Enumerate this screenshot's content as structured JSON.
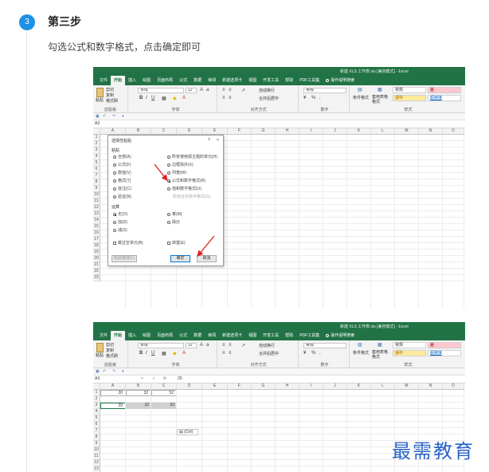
{
  "step": {
    "number": "3",
    "title": "第三步",
    "description": "勾选公式和数字格式，点击确定即可"
  },
  "excel": {
    "title1": "新建 XLS 工作表.xls [兼容模式] - Excel",
    "title2": "新建 XLS 工作表.xls [兼容模式] - Excel",
    "tabs": [
      "文件",
      "开始",
      "插入",
      "绘图",
      "页面布局",
      "公式",
      "数据",
      "审阅",
      "新建选项卡",
      "视图",
      "开发工具",
      "帮助",
      "PDF工具集",
      "操作说明搜索"
    ],
    "ribbon": {
      "paste": "粘贴",
      "cut": "剪切",
      "copy": "复制",
      "format_painter": "格式刷",
      "clipboard_label": "剪贴板",
      "font_name": "宋体",
      "font_size": "12",
      "font_label": "字体",
      "wrap_text": "自动换行",
      "merge_center": "合并后居中",
      "align_label": "对齐方式",
      "number_format": "常规",
      "number_label": "数字",
      "cond_format": "条件格式",
      "table_format": "套用表格格式",
      "style_normal": "常规",
      "style_bad": "差",
      "style_neutral": "适中",
      "style_hyperlink": "超链接",
      "styles_label": "样式"
    },
    "name_box": "A3",
    "formula_value": "20",
    "columns": [
      "A",
      "B",
      "C",
      "D",
      "E",
      "F",
      "G",
      "H",
      "I",
      "J",
      "K",
      "L",
      "M",
      "N",
      "O"
    ],
    "rows1": [
      "1",
      "2",
      "3",
      "4",
      "5",
      "6",
      "7",
      "8",
      "9",
      "10",
      "11",
      "12",
      "13",
      "14",
      "15",
      "16",
      "17",
      "18",
      "19",
      "20",
      "21",
      "22",
      "23"
    ],
    "rows2": [
      "1",
      "2",
      "3",
      "4",
      "5",
      "6",
      "7",
      "8",
      "9",
      "10",
      "11",
      "12",
      "13",
      "14"
    ],
    "cells2": {
      "r1": [
        "20",
        "32",
        "52"
      ],
      "r3": [
        "20",
        "32",
        "52"
      ]
    },
    "paste_options": "(Ctrl)"
  },
  "dialog": {
    "title": "选择性粘贴",
    "help": "?",
    "close": "×",
    "paste_section": "粘贴",
    "options_left": [
      "全部(A)",
      "公式(F)",
      "数值(V)",
      "格式(T)",
      "批注(C)",
      "验证(N)"
    ],
    "options_right": [
      "所有使用源主题的单元(H)",
      "边框除外(X)",
      "列宽(W)",
      "公式和数字格式(R)",
      "值和数字格式(U)",
      "所有合并条件格式(G)"
    ],
    "operation_section": "运算",
    "op_left": [
      "无(O)",
      "加(D)",
      "减(S)"
    ],
    "op_right": [
      "乘(M)",
      "除(I)"
    ],
    "skip_blanks": "跳过空单元(B)",
    "transpose": "转置(E)",
    "paste_link": "粘贴链接(L)",
    "ok": "确定",
    "cancel": "取消"
  },
  "watermark": "最需教育",
  "colors": {
    "badge": "#1e90e6",
    "excel_green": "#217346",
    "arrow_red": "#e02020",
    "watermark": "#2a64c8"
  }
}
